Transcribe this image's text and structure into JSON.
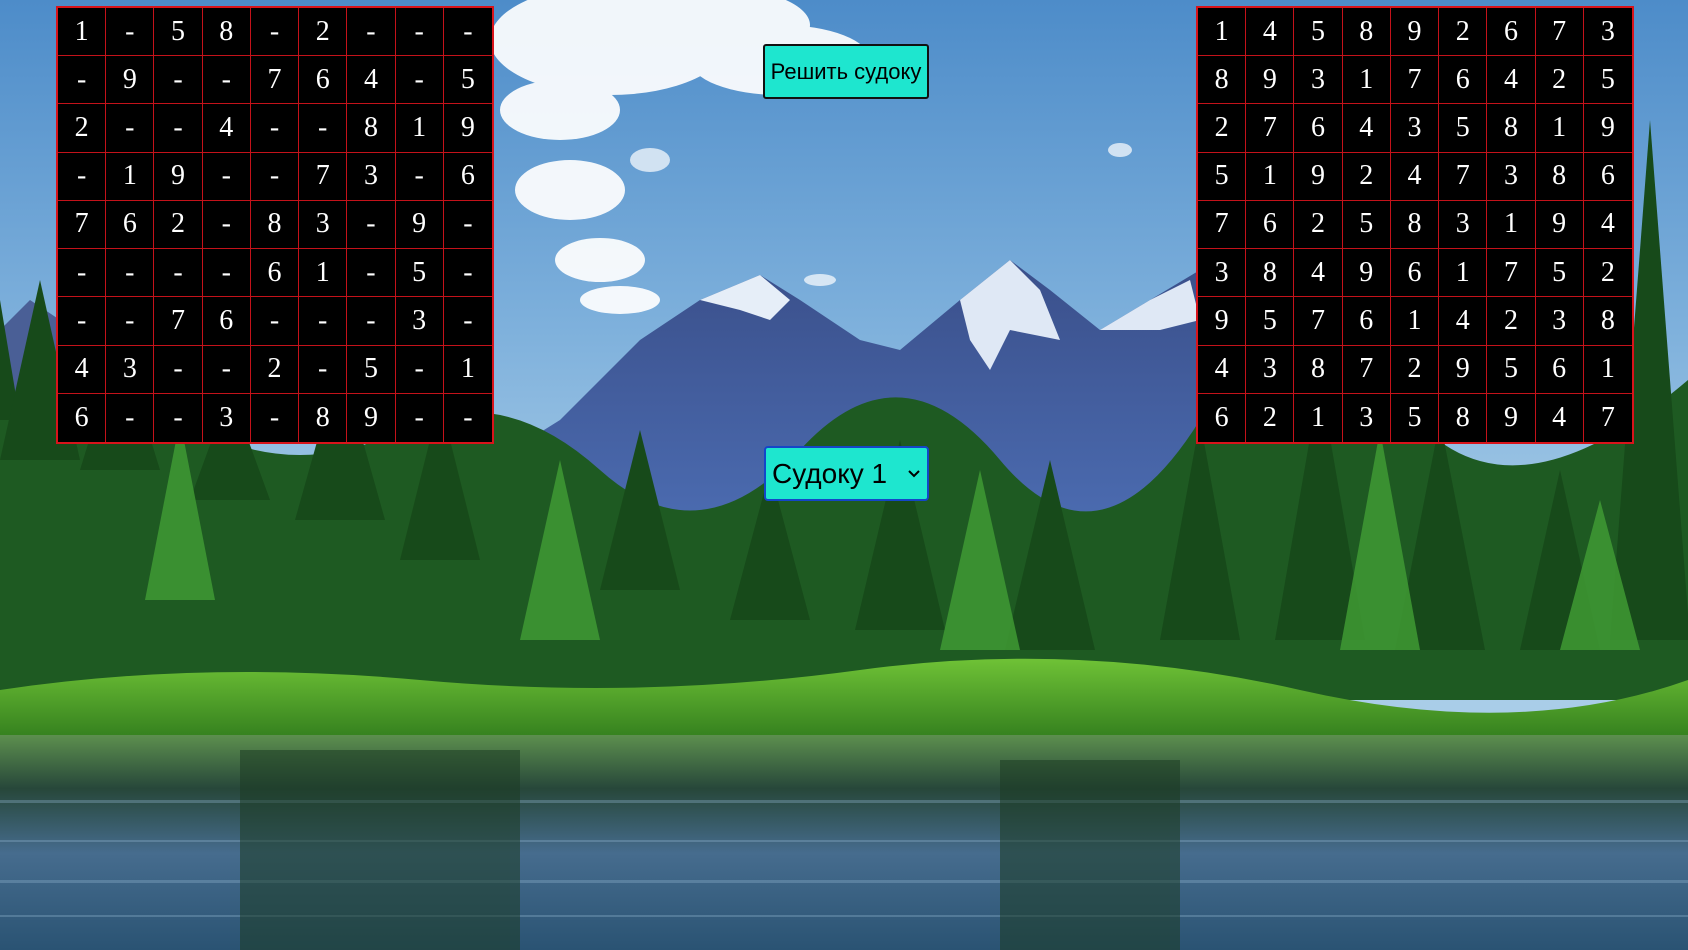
{
  "controls": {
    "solve_label": "Решить судоку",
    "puzzle_select_value": "Судоку 1"
  },
  "colors": {
    "button_bg": "#1ee6cf",
    "grid_line": "#d8141b",
    "cell_bg": "#000000",
    "digit": "#ffffff"
  },
  "icons": {
    "select_arrow": "chevron-down-icon"
  },
  "puzzle": {
    "rows": [
      [
        "1",
        "-",
        "5",
        "8",
        "-",
        "2",
        "-",
        "-",
        "-"
      ],
      [
        "-",
        "9",
        "-",
        "-",
        "7",
        "6",
        "4",
        "-",
        "5"
      ],
      [
        "2",
        "-",
        "-",
        "4",
        "-",
        "-",
        "8",
        "1",
        "9"
      ],
      [
        "-",
        "1",
        "9",
        "-",
        "-",
        "7",
        "3",
        "-",
        "6"
      ],
      [
        "7",
        "6",
        "2",
        "-",
        "8",
        "3",
        "-",
        "9",
        "-"
      ],
      [
        "-",
        "-",
        "-",
        "-",
        "6",
        "1",
        "-",
        "5",
        "-"
      ],
      [
        "-",
        "-",
        "7",
        "6",
        "-",
        "-",
        "-",
        "3",
        "-"
      ],
      [
        "4",
        "3",
        "-",
        "-",
        "2",
        "-",
        "5",
        "-",
        "1"
      ],
      [
        "6",
        "-",
        "-",
        "3",
        "-",
        "8",
        "9",
        "-",
        "-"
      ]
    ]
  },
  "solution": {
    "rows": [
      [
        "1",
        "4",
        "5",
        "8",
        "9",
        "2",
        "6",
        "7",
        "3"
      ],
      [
        "8",
        "9",
        "3",
        "1",
        "7",
        "6",
        "4",
        "2",
        "5"
      ],
      [
        "2",
        "7",
        "6",
        "4",
        "3",
        "5",
        "8",
        "1",
        "9"
      ],
      [
        "5",
        "1",
        "9",
        "2",
        "4",
        "7",
        "3",
        "8",
        "6"
      ],
      [
        "7",
        "6",
        "2",
        "5",
        "8",
        "3",
        "1",
        "9",
        "4"
      ],
      [
        "3",
        "8",
        "4",
        "9",
        "6",
        "1",
        "7",
        "5",
        "2"
      ],
      [
        "9",
        "5",
        "7",
        "6",
        "1",
        "4",
        "2",
        "3",
        "8"
      ],
      [
        "4",
        "3",
        "8",
        "7",
        "2",
        "9",
        "5",
        "6",
        "1"
      ],
      [
        "6",
        "2",
        "1",
        "3",
        "5",
        "8",
        "9",
        "4",
        "7"
      ]
    ]
  }
}
